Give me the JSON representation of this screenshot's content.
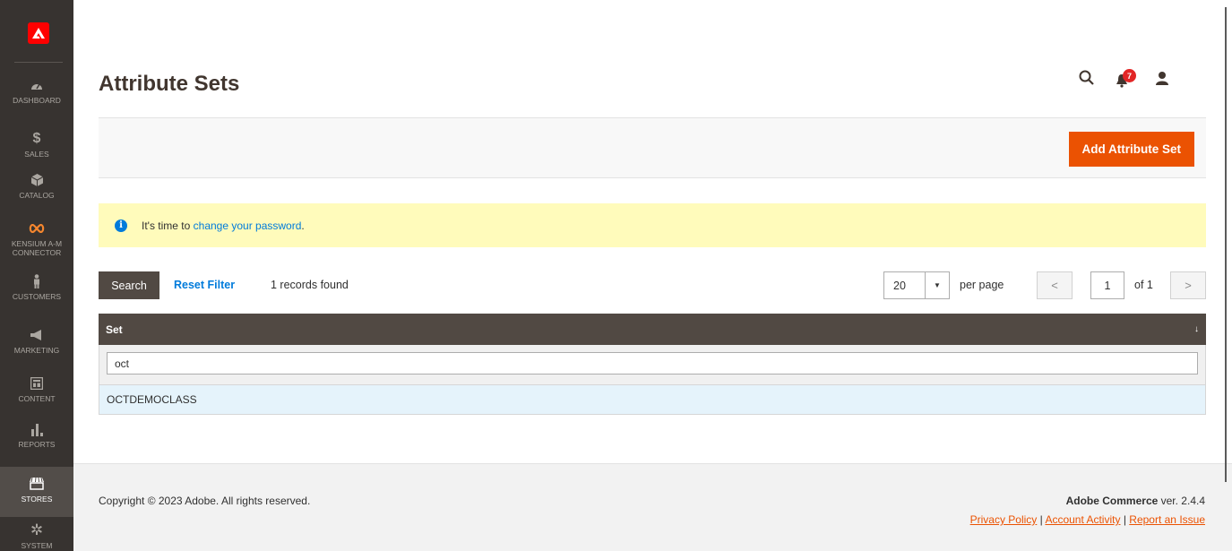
{
  "sidebar": {
    "items": [
      {
        "label": "DASHBOARD",
        "icon": "dashboard-gauge-icon"
      },
      {
        "label": "SALES",
        "icon": "dollar-icon"
      },
      {
        "label": "CATALOG",
        "icon": "box-icon"
      },
      {
        "label_line1": "KENSIUM A-M",
        "label_line2": "CONNECTOR",
        "icon": "infinity-icon",
        "icon_color": "#f5862e"
      },
      {
        "label": "CUSTOMERS",
        "icon": "person-icon"
      },
      {
        "label": "MARKETING",
        "icon": "megaphone-icon"
      },
      {
        "label": "CONTENT",
        "icon": "layout-icon"
      },
      {
        "label": "REPORTS",
        "icon": "bar-chart-icon"
      },
      {
        "label": "STORES",
        "icon": "store-icon",
        "active": true
      },
      {
        "label": "SYSTEM",
        "icon": "gear-icon"
      }
    ]
  },
  "header": {
    "title": "Attribute Sets",
    "notification_count": "7"
  },
  "actions": {
    "add_label": "Add Attribute Set"
  },
  "message": {
    "prefix": "It's time to",
    "link": "change your password",
    "suffix": "."
  },
  "toolbar": {
    "search_label": "Search",
    "reset_label": "Reset Filter",
    "records": "1 records found",
    "per_page_value": "20",
    "per_page_label": "per page",
    "page_value": "1",
    "page_of": "of 1"
  },
  "grid": {
    "column": "Set",
    "sort_indicator": "↓",
    "filter_value": "oct",
    "rows": [
      {
        "set": "OCTDEMOCLASS"
      }
    ]
  },
  "footer": {
    "copyright": "Copyright © 2023 Adobe. All rights reserved.",
    "brand": "Adobe Commerce",
    "version": " ver. 2.4.4",
    "link_privacy": "Privacy Policy",
    "link_activity": "Account Activity",
    "link_issue": "Report an Issue",
    "separator": " | "
  },
  "colors": {
    "sidebar_bg": "#373330",
    "accent": "#eb5202",
    "grid_header": "#514943",
    "message_bg": "#fffbbb",
    "link": "#007bdb"
  }
}
